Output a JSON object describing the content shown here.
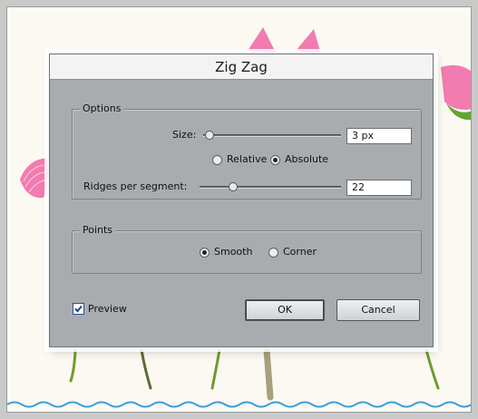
{
  "dialog": {
    "title": "Zig Zag",
    "options": {
      "legend": "Options",
      "size_label": "Size:",
      "size_value": "3 px",
      "relative_label": "Relative",
      "absolute_label": "Absolute",
      "mode_selected": "Absolute",
      "ridges_label": "Ridges per segment:",
      "ridges_value": "22"
    },
    "points": {
      "legend": "Points",
      "smooth_label": "Smooth",
      "corner_label": "Corner",
      "selected": "Smooth"
    },
    "preview_label": "Preview",
    "preview_checked": true,
    "ok_label": "OK",
    "cancel_label": "Cancel"
  },
  "artwork": {
    "flower_color": "#f27bb0",
    "stem_color": "#6f9c2e",
    "wave_color": "#3aa0d8"
  }
}
